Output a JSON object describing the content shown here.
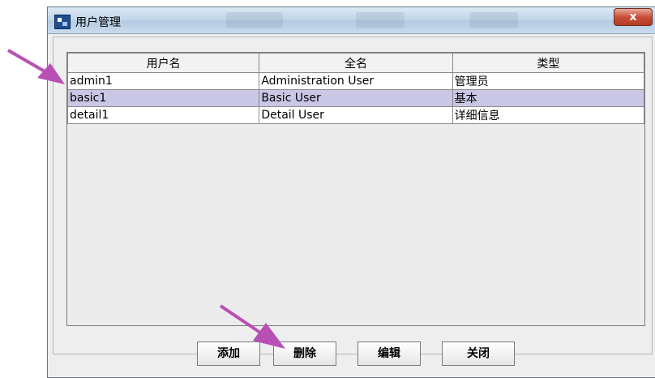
{
  "window": {
    "title": "用户管理",
    "close_icon": "close-icon",
    "close_glyph": "x"
  },
  "table": {
    "columns": [
      "用户名",
      "全名",
      "类型"
    ],
    "rows": [
      {
        "username": "admin1",
        "fullname": "Administration User",
        "type": "管理员",
        "selected": false
      },
      {
        "username": "basic1",
        "fullname": "Basic User",
        "type": "基本",
        "selected": true
      },
      {
        "username": "detail1",
        "fullname": "Detail User",
        "type": "详细信息",
        "selected": false
      }
    ]
  },
  "buttons": {
    "add": "添加",
    "delete": "删除",
    "edit": "编辑",
    "close": "关闭"
  },
  "annotations": {
    "arrow_color": "#b84fb5",
    "arrows": [
      "pointer to selected row",
      "pointer to delete button"
    ]
  }
}
